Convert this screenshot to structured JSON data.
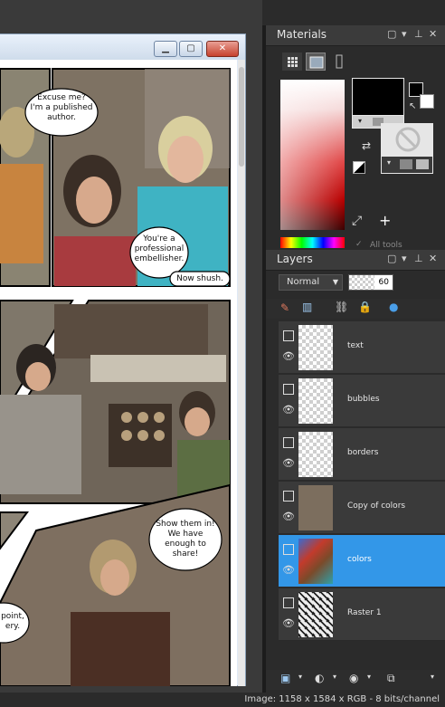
{
  "document_window": {
    "min_icon": "minimize-icon",
    "max_icon": "maximize-icon",
    "close_icon": "close-icon"
  },
  "comic": {
    "bubbles": [
      "Excuse me? I'm a published author.",
      "You're a professional embellisher.",
      "Now shush.",
      "Show them in! We have enough to share!",
      "point, ery."
    ]
  },
  "materials": {
    "title": "Materials",
    "foreground_color": "#000000",
    "background_color": "#e6e6e6",
    "hint": "All tools"
  },
  "layers": {
    "title": "Layers",
    "blend_mode": "Normal",
    "opacity": "60",
    "items": [
      {
        "name": "text",
        "selected": false
      },
      {
        "name": "bubbles",
        "selected": false
      },
      {
        "name": "borders",
        "selected": false
      },
      {
        "name": "Copy of colors",
        "selected": false
      },
      {
        "name": "colors",
        "selected": true
      },
      {
        "name": "Raster 1",
        "selected": false
      }
    ]
  },
  "status_bar": {
    "text": "Image:  1158 x 1584 x RGB - 8 bits/channel"
  },
  "colors": {
    "accent": "#3397e8",
    "panel_bg": "#2d2d2d",
    "workspace_bg": "#3a3a3a"
  }
}
